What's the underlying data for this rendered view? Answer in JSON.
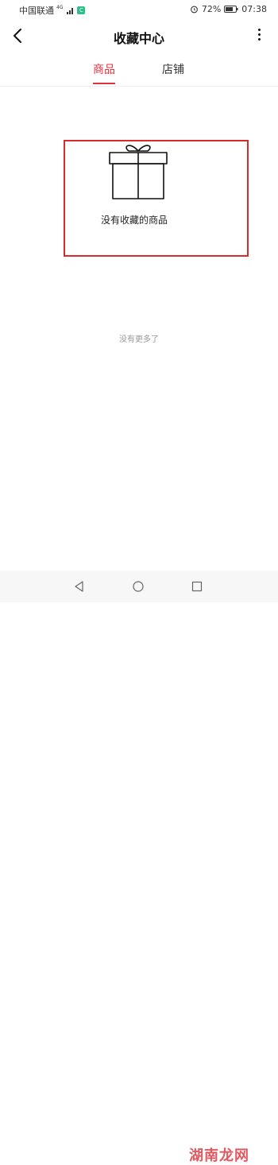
{
  "status_bar": {
    "carrier": "中国联通",
    "network": "4G",
    "app_badge": "C",
    "battery": "72%",
    "time": "07:38"
  },
  "header": {
    "title": "收藏中心",
    "back_icon": "chevron-left-icon",
    "more_icon": "more-vertical-icon"
  },
  "tabs": [
    {
      "label": "商品",
      "active": true
    },
    {
      "label": "店铺",
      "active": false
    }
  ],
  "empty_state": {
    "icon": "gift-box-icon",
    "text": "没有收藏的商品"
  },
  "footer_text": "没有更多了",
  "watermark": "湖南龙网",
  "colors": {
    "accent": "#e2333d",
    "highlight_box": "#d92b2b"
  }
}
